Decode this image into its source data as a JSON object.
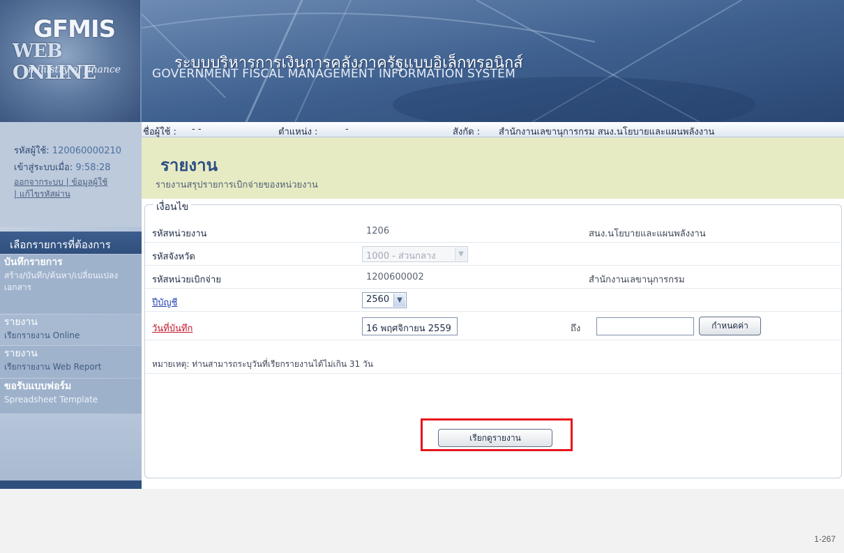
{
  "header": {
    "logo_line1": "GFMIS",
    "logo_line2": "WEB ONLINE",
    "logo_line3": "ministry of finance",
    "system_title_th": "ระบบบริหารการเงินการคลังภาครัฐแบบอิเล็กทรอนิกส์",
    "system_title_en": "GOVERNMENT FISCAL MANAGEMENT INFORMATION SYSTEM"
  },
  "sidebar": {
    "user_id_label": "รหัสผู้ใช้:",
    "user_id_value": "120060000210",
    "login_time_label": "เข้าสู่ระบบเมื่อ:",
    "login_time_value": "9:58:28",
    "logout_link": "ออกจากระบบ",
    "user_info_link": "ข้อมูลผู้ใช้",
    "change_password_link": "แก้ไขรหัสผ่าน",
    "menu_header": "เลือกรายการที่ต้องการ",
    "items": [
      {
        "title": "บันทึกรายการ",
        "subtitle": "สร้าง/บันทึก/ค้นหา/เปลี่ยนแปลง เอกสาร"
      },
      {
        "title": "รายงาน",
        "subtitle": "เรียกรายงาน Online"
      },
      {
        "title": "รายงาน",
        "subtitle": "เรียกรายงาน Web Report"
      },
      {
        "title": "ขอรับแบบฟอร์ม",
        "subtitle": "Spreadsheet Template"
      }
    ]
  },
  "info_bar": {
    "username_label": "ชื่อผู้ใช้ :",
    "username_value": "- -",
    "position_label": "ตำแหน่ง :",
    "position_value": "-",
    "affiliation_label": "สังกัด :",
    "affiliation_value": "สำนักงานเลขานุการกรม สนง.นโยบายและแผนพลังงาน"
  },
  "page": {
    "title": "รายงาน",
    "subtitle": "รายงานสรุปรายการเบิกจ่ายของหน่วยงาน"
  },
  "conditions": {
    "legend": "เงื่อนไข",
    "agency_code_label": "รหัสหน่วยงาน",
    "agency_code_value": "1206",
    "agency_name": "สนง.นโยบายและแผนพลังงาน",
    "province_label": "รหัสจังหวัด",
    "province_value": "1000 - ส่วนกลาง",
    "disbursement_unit_label": "รหัสหน่วยเบิกจ่าย",
    "disbursement_unit_value": "1200600002",
    "disbursement_unit_name": "สำนักงานเลขานุการกรม",
    "fiscal_year_label": "ปีบัญชี",
    "fiscal_year_value": "2560",
    "record_date_label": "วันที่บันทึก",
    "date_from_value": "16 พฤศจิกายน 2559",
    "to_label": "ถึง",
    "date_to_value": "",
    "set_value_button": "กำหนดค่า",
    "note": "หมายเหตุ: ท่านสามารถระบุวันที่เรียกรายงานได้ไม่เกิน 31 วัน",
    "view_report_button": "เรียกดูรายงาน"
  },
  "footer": {
    "page_number": "1-267"
  },
  "colors": {
    "header_blue": "#3e5f8c",
    "page_head_bg": "#e7ebc4",
    "highlight_red": "#e8141c",
    "required_label_red": "#c3142a",
    "link_blue": "#1f3fb0"
  }
}
